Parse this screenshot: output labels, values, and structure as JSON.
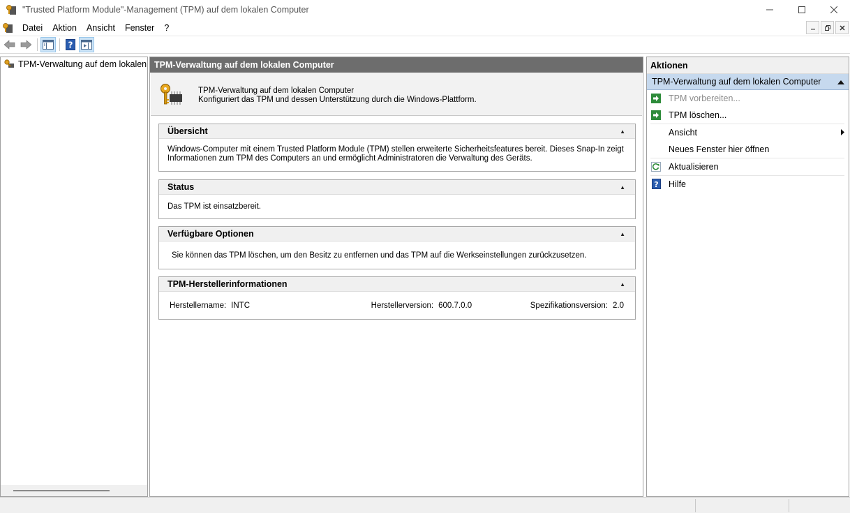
{
  "window": {
    "title": "\"Trusted Platform Module\"-Management (TPM) auf dem lokalen Computer",
    "minimize": "—",
    "maximize": "☐",
    "close": "✕"
  },
  "menu": {
    "items": [
      "Datei",
      "Aktion",
      "Ansicht",
      "Fenster",
      "?"
    ]
  },
  "tree": {
    "root_label": "TPM-Verwaltung auf dem lokalen Computer"
  },
  "center": {
    "header": "TPM-Verwaltung auf dem lokalen Computer",
    "intro_title": "TPM-Verwaltung auf dem lokalen Computer",
    "intro_desc": "Konfiguriert das TPM und dessen Unterstützung durch die Windows-Plattform.",
    "sections": {
      "overview": {
        "title": "Übersicht",
        "line1": "Windows-Computer mit einem Trusted Platform Module (TPM) stellen erweiterte Sicherheitsfeatures bereit. Dieses Snap-In zeigt",
        "line2": "Informationen zum TPM des Computers an und ermöglicht Administratoren die Verwaltung des Geräts."
      },
      "status": {
        "title": "Status",
        "text": "Das TPM ist einsatzbereit."
      },
      "options": {
        "title": "Verfügbare Optionen",
        "text": "Sie können das TPM löschen, um den Besitz zu entfernen und das TPM auf die Werkseinstellungen zurückzusetzen."
      },
      "manufacturer": {
        "title": "TPM-Herstellerinformationen",
        "name_label": "Herstellername:",
        "name_value": "INTC",
        "version_label": "Herstellerversion:",
        "version_value": "600.7.0.0",
        "spec_label": "Spezifikationsversion:",
        "spec_value": "2.0"
      }
    }
  },
  "actions": {
    "header": "Aktionen",
    "group_title": "TPM-Verwaltung auf dem lokalen Computer",
    "items": {
      "prepare": "TPM vorbereiten...",
      "clear": "TPM löschen...",
      "view": "Ansicht",
      "new_window": "Neues Fenster hier öffnen",
      "refresh": "Aktualisieren",
      "help": "Hilfe"
    }
  },
  "icons": {
    "app": "tpm-app-icon",
    "mmc": "mmc-icon",
    "back": "back-arrow-icon",
    "forward": "forward-arrow-icon",
    "console_tree": "show-hide-console-tree-icon",
    "help": "help-icon",
    "action_pane": "show-hide-action-pane-icon",
    "key": "key-chip-icon",
    "run": "green-arrow-icon",
    "refresh": "refresh-icon"
  },
  "colors": {
    "center_header_bg": "#6d6d6d",
    "actions_group_bg": "#c6d9ee",
    "run_icon_green": "#2e8b3a",
    "help_icon_blue": "#2a5db0"
  }
}
